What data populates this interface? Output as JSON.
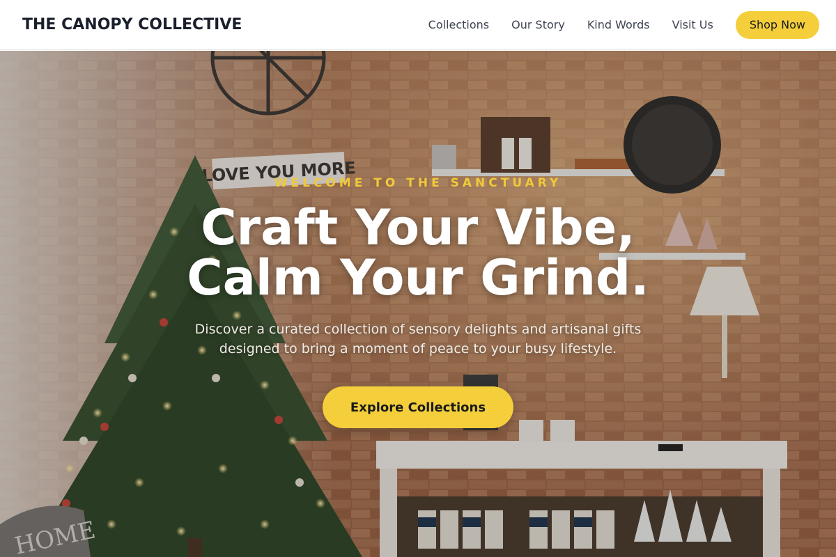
{
  "header": {
    "brand": "THE CANOPY COLLECTIVE",
    "nav": [
      "Collections",
      "Our Story",
      "Kind Words",
      "Visit Us"
    ],
    "cta_label": "Shop Now"
  },
  "hero": {
    "eyebrow": "WELCOME TO THE SANCTUARY",
    "headline_line1": "Craft Your Vibe,",
    "headline_line2": "Calm Your Grind.",
    "subtext": "Discover a curated collection of sensory delights and artisanal gifts designed to bring a moment of peace to your busy lifestyle.",
    "button_label": "Explore Collections",
    "background_text": "LOVE YOU MORE",
    "background_text_2": "HOME"
  },
  "colors": {
    "accent_yellow": "#f4cf3b",
    "eyebrow_yellow": "#f0c93a",
    "brand_text": "#1a1f2b",
    "nav_text": "#3d4350",
    "brick": "#a46a4c"
  }
}
